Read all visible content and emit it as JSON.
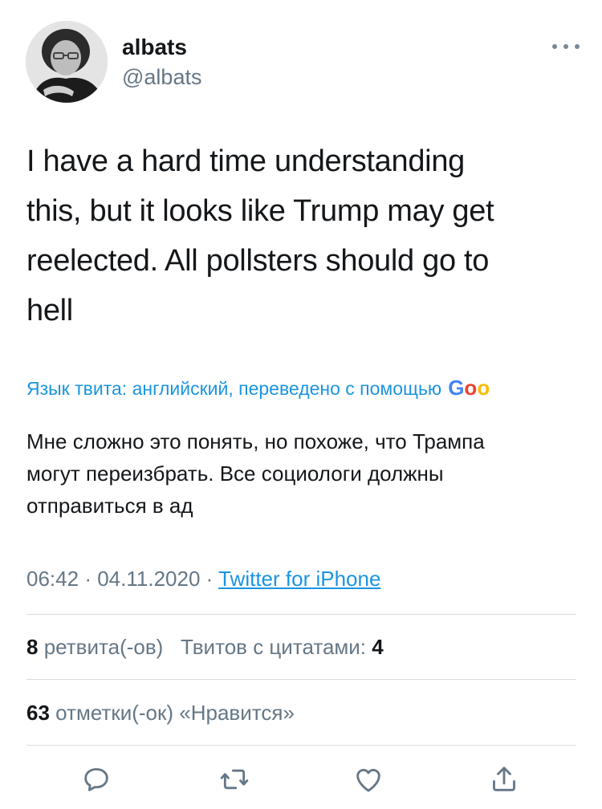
{
  "author": {
    "name": "albats",
    "handle": "@albats"
  },
  "tweet": {
    "text": "I have a hard time understanding\nthis, but it looks like Trump may get\nreelected. All pollsters should go to\nhell",
    "translation_notice": "Язык твита: английский, переведено с помощью",
    "translation_brand": "Goo",
    "translated_text": "Мне сложно это понять, но похоже, что Трампа\nмогут переизбрать. Все социологи должны\nотправиться в ад"
  },
  "meta": {
    "time": "06:42",
    "separator": "·",
    "date": "04.11.2020",
    "source": "Twitter for iPhone"
  },
  "stats": {
    "retweets_count": "8",
    "retweets_label": "ретвита(-ов)",
    "quotes_label": "Твитов с цитатами:",
    "quotes_count": "4",
    "likes_count": "63",
    "likes_label": "отметки(-ок) «Нравится»"
  },
  "actions": [
    {
      "icon": "reply-icon"
    },
    {
      "icon": "retweet-icon"
    },
    {
      "icon": "like-icon"
    },
    {
      "icon": "share-icon"
    }
  ],
  "colors": {
    "link": "#1b95e0",
    "secondary_text": "#657786",
    "primary_text": "#14171a",
    "divider": "#d7dde2"
  }
}
